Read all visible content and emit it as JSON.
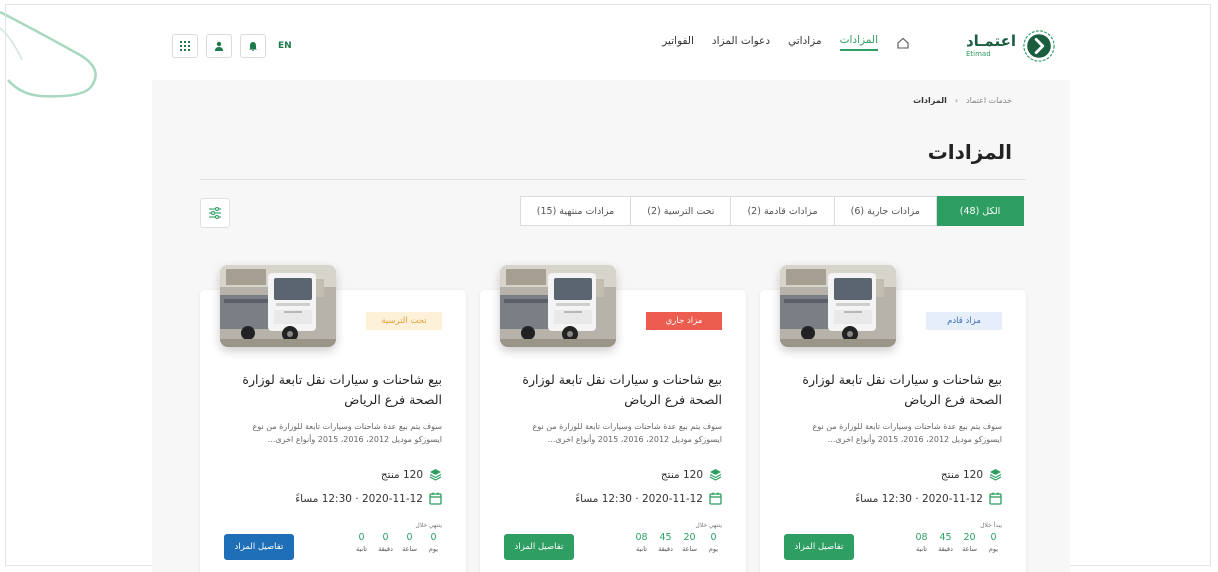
{
  "header": {
    "logo_ar": "اعتمـاد",
    "logo_en": "Etimad",
    "nav": [
      "المزادات",
      "مزاداتي",
      "دعوات المزاد",
      "الفواتير"
    ],
    "lang": "EN"
  },
  "breadcrumb": {
    "root": "خدمات اعتماد",
    "current": "المزادات"
  },
  "page_title": "المزادات",
  "tabs": [
    "الكل (48)",
    "مزادات جارية (6)",
    "مزادات قادمة (2)",
    "تحت الترسية (2)",
    "مزادات منتهية (15)"
  ],
  "cards": [
    {
      "status": "مزاد قادم",
      "title": "بيع شاحنات و سيارات نقل تابعة لوزارة الصحة فرع الرياض",
      "desc": "سوف يتم بيع عدة شاحنات وسيارات تابعة للوزارة من نوع ايسوزكو موديل 2012، 2016، 2015 وأنواع اخرى...",
      "products": "120 منتج",
      "date": "2020-11-12 · 12:30 مساءً",
      "countdown_label": "يبدأ خلال",
      "countdown": [
        {
          "v": "0",
          "l": "يوم"
        },
        {
          "v": "20",
          "l": "ساعة"
        },
        {
          "v": "45",
          "l": "دقيقة"
        },
        {
          "v": "08",
          "l": "ثانية"
        }
      ],
      "btn": "تفاصيل المزاد"
    },
    {
      "status": "مزاد جاري",
      "title": "بيع شاحنات و سيارات نقل تابعة لوزارة الصحة فرع الرياض",
      "desc": "سوف يتم بيع عدة شاحنات وسيارات تابعة للوزارة من نوع ايسوزكو موديل 2012، 2016، 2015 وأنواع اخرى...",
      "products": "120 منتج",
      "date": "2020-11-12 · 12:30 مساءً",
      "countdown_label": "ينتهي خلال",
      "countdown": [
        {
          "v": "0",
          "l": "يوم"
        },
        {
          "v": "20",
          "l": "ساعة"
        },
        {
          "v": "45",
          "l": "دقيقة"
        },
        {
          "v": "08",
          "l": "ثانية"
        }
      ],
      "btn": "تفاصيل المزاد"
    },
    {
      "status": "تحت الترسية",
      "title": "بيع شاحنات و سيارات نقل تابعة لوزارة الصحة فرع الرياض",
      "desc": "سوف يتم بيع عدة شاحنات وسيارات تابعة للوزارة من نوع ايسوزكو موديل 2012، 2016، 2015 وأنواع اخرى...",
      "products": "120 منتج",
      "date": "2020-11-12 · 12:30 مساءً",
      "countdown_label": "ينتهي خلال",
      "countdown": [
        {
          "v": "0",
          "l": "يوم"
        },
        {
          "v": "0",
          "l": "ساعة"
        },
        {
          "v": "0",
          "l": "دقيقة"
        },
        {
          "v": "0",
          "l": "ثانية"
        }
      ],
      "btn": "تفاصيل المزاد"
    }
  ],
  "icons": {
    "home": "home-icon",
    "grid": "grid-icon",
    "user": "user-icon",
    "bell": "bell-icon",
    "filter": "filter-icon",
    "layers": "layers-icon",
    "calendar": "calendar-icon"
  },
  "colors": {
    "primary": "#2e9e63",
    "upcoming_badge_bg": "#e6eef9",
    "upcoming_badge_text": "#3c6fb4",
    "live_badge_bg": "#ec5d50",
    "award_badge_bg": "#fdf1da",
    "award_badge_text": "#e2a23a",
    "btn_green": "#2e9e63",
    "btn_blue": "#1f6fb8"
  }
}
